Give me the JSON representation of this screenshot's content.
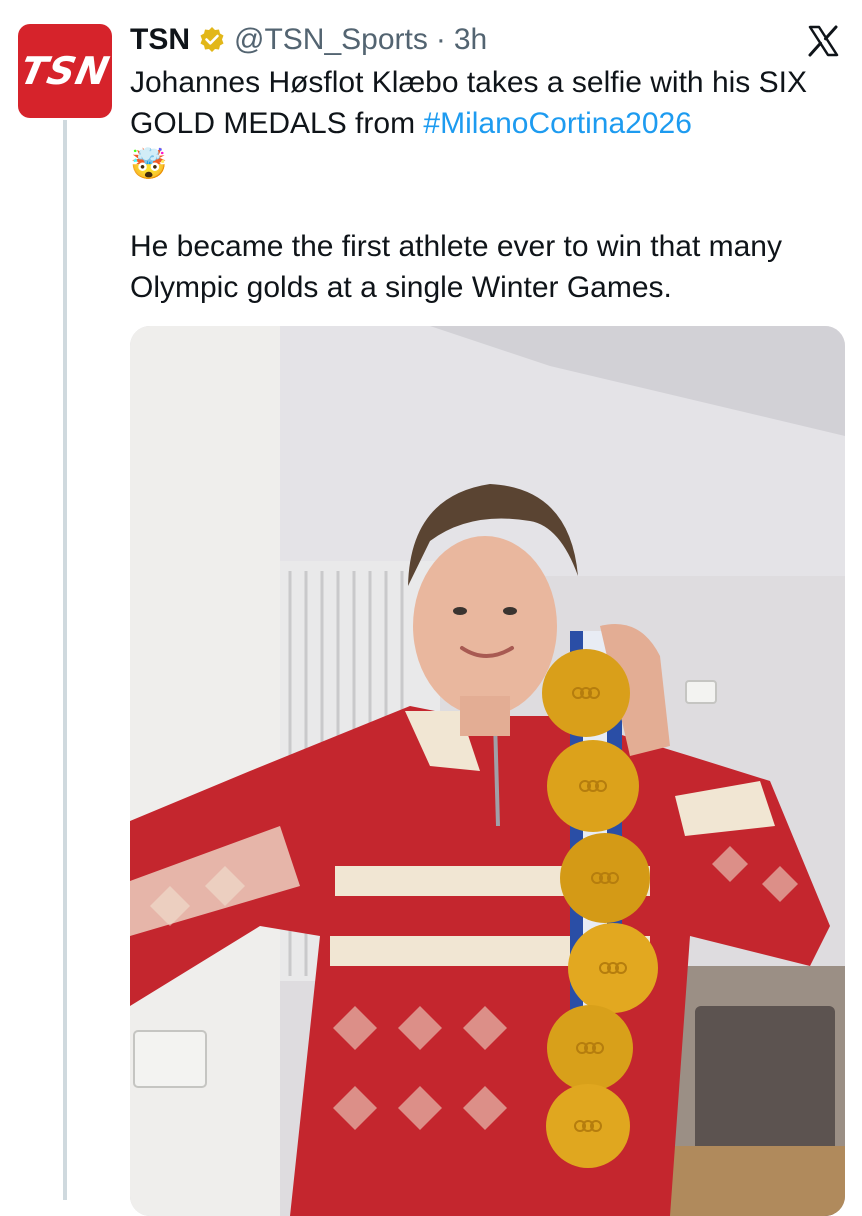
{
  "tweet": {
    "avatar": {
      "icon": "tsn-logo-icon",
      "text": "TSN",
      "color": "#d6232b"
    },
    "display_name": "TSN",
    "verified_icon": "verified-badge-icon",
    "handle": "@TSN_Sports",
    "separator": "·",
    "time": "3h",
    "close_icon": "x-logo-icon",
    "text_line_1_a": "Johannes Høsflot Klæbo takes a selfie with his SIX GOLD MEDALS from ",
    "hashtag": "#MilanoCortina2026",
    "emoji": "🤯",
    "text_para_2": "He became the first athlete ever to win that many Olympic golds at a single Winter Games.",
    "link_color": "#1d9bf0"
  },
  "media": {
    "type": "photo"
  }
}
